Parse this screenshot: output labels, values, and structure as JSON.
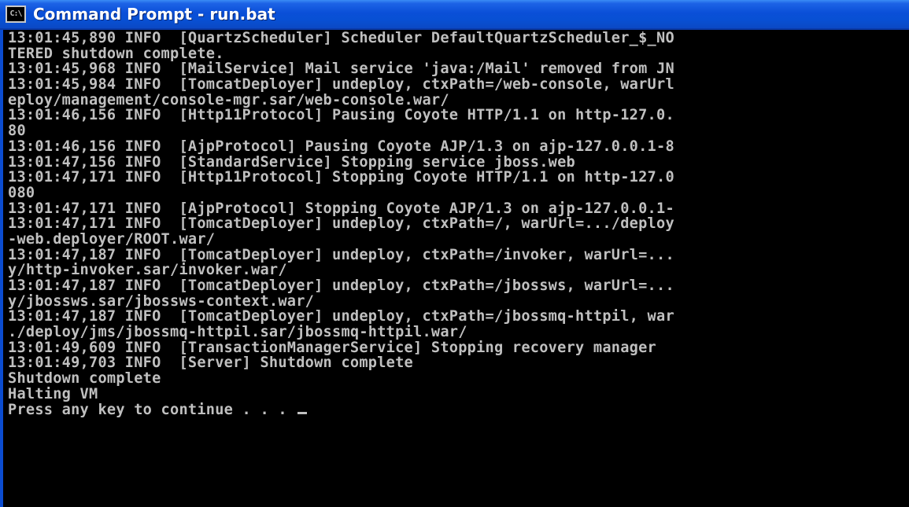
{
  "window": {
    "title": "Command Prompt - run.bat",
    "icon": "C:\\"
  },
  "console": {
    "lines": [
      "13:01:45,890 INFO  [QuartzScheduler] Scheduler DefaultQuartzScheduler_$_NO",
      "TERED shutdown complete.",
      "13:01:45,968 INFO  [MailService] Mail service 'java:/Mail' removed from JN",
      "13:01:45,984 INFO  [TomcatDeployer] undeploy, ctxPath=/web-console, warUrl",
      "eploy/management/console-mgr.sar/web-console.war/",
      "13:01:46,156 INFO  [Http11Protocol] Pausing Coyote HTTP/1.1 on http-127.0.",
      "80",
      "13:01:46,156 INFO  [AjpProtocol] Pausing Coyote AJP/1.3 on ajp-127.0.0.1-8",
      "13:01:47,156 INFO  [StandardService] Stopping service jboss.web",
      "13:01:47,171 INFO  [Http11Protocol] Stopping Coyote HTTP/1.1 on http-127.0",
      "080",
      "13:01:47,171 INFO  [AjpProtocol] Stopping Coyote AJP/1.3 on ajp-127.0.0.1-",
      "13:01:47,171 INFO  [TomcatDeployer] undeploy, ctxPath=/, warUrl=.../deploy",
      "-web.deployer/ROOT.war/",
      "13:01:47,187 INFO  [TomcatDeployer] undeploy, ctxPath=/invoker, warUrl=...",
      "y/http-invoker.sar/invoker.war/",
      "13:01:47,187 INFO  [TomcatDeployer] undeploy, ctxPath=/jbossws, warUrl=...",
      "y/jbossws.sar/jbossws-context.war/",
      "13:01:47,187 INFO  [TomcatDeployer] undeploy, ctxPath=/jbossmq-httpil, war",
      "./deploy/jms/jbossmq-httpil.sar/jbossmq-httpil.war/",
      "13:01:49,609 INFO  [TransactionManagerService] Stopping recovery manager",
      "13:01:49,703 INFO  [Server] Shutdown complete",
      "Shutdown complete",
      "Halting VM",
      "Press any key to continue . . . "
    ]
  }
}
